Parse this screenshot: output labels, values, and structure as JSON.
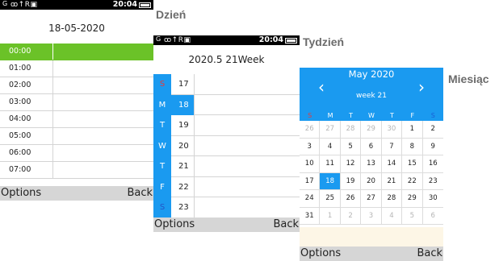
{
  "captions": {
    "day": "Dzień",
    "week": "Tydzień",
    "month": "Miesiąc"
  },
  "status": {
    "signal": "G",
    "icons": "ꝏ↑R▣",
    "time": "20:04"
  },
  "softkeys": {
    "left": "Options",
    "right": "Back"
  },
  "day_view": {
    "title": "18-05-2020",
    "hours": [
      "00:00",
      "01:00",
      "02:00",
      "03:00",
      "04:00",
      "05:00",
      "06:00",
      "07:00"
    ],
    "selected_index": 0,
    "accent": "#6bc228"
  },
  "week_view": {
    "title": "2020.5 21Week",
    "days": [
      {
        "wd": "S",
        "d": "17"
      },
      {
        "wd": "M",
        "d": "18"
      },
      {
        "wd": "T",
        "d": "19"
      },
      {
        "wd": "W",
        "d": "20"
      },
      {
        "wd": "T",
        "d": "21"
      },
      {
        "wd": "F",
        "d": "22"
      },
      {
        "wd": "S",
        "d": "23"
      }
    ],
    "selected_index": 1,
    "accent": "#1a9af0"
  },
  "month_view": {
    "month": "May 2020",
    "week": "week 21",
    "prev_icon": "chevron-left-icon",
    "next_icon": "chevron-right-icon",
    "weekdays": [
      "S",
      "M",
      "T",
      "W",
      "T",
      "F",
      "S"
    ],
    "cells": [
      {
        "d": "26",
        "dim": true
      },
      {
        "d": "27",
        "dim": true
      },
      {
        "d": "28",
        "dim": true
      },
      {
        "d": "29",
        "dim": true
      },
      {
        "d": "30",
        "dim": true
      },
      {
        "d": "1"
      },
      {
        "d": "2"
      },
      {
        "d": "3"
      },
      {
        "d": "4"
      },
      {
        "d": "5"
      },
      {
        "d": "6"
      },
      {
        "d": "7"
      },
      {
        "d": "8"
      },
      {
        "d": "9"
      },
      {
        "d": "10"
      },
      {
        "d": "11"
      },
      {
        "d": "12"
      },
      {
        "d": "13"
      },
      {
        "d": "14"
      },
      {
        "d": "15"
      },
      {
        "d": "16"
      },
      {
        "d": "17"
      },
      {
        "d": "18",
        "sel": true
      },
      {
        "d": "19"
      },
      {
        "d": "20"
      },
      {
        "d": "21"
      },
      {
        "d": "22"
      },
      {
        "d": "23"
      },
      {
        "d": "24"
      },
      {
        "d": "25"
      },
      {
        "d": "26"
      },
      {
        "d": "27"
      },
      {
        "d": "28"
      },
      {
        "d": "29"
      },
      {
        "d": "30"
      },
      {
        "d": "31"
      },
      {
        "d": "1",
        "dim": true
      },
      {
        "d": "2",
        "dim": true
      },
      {
        "d": "3",
        "dim": true
      },
      {
        "d": "4",
        "dim": true
      },
      {
        "d": "5",
        "dim": true
      },
      {
        "d": "6",
        "dim": true
      }
    ],
    "accent": "#1a9af0"
  }
}
